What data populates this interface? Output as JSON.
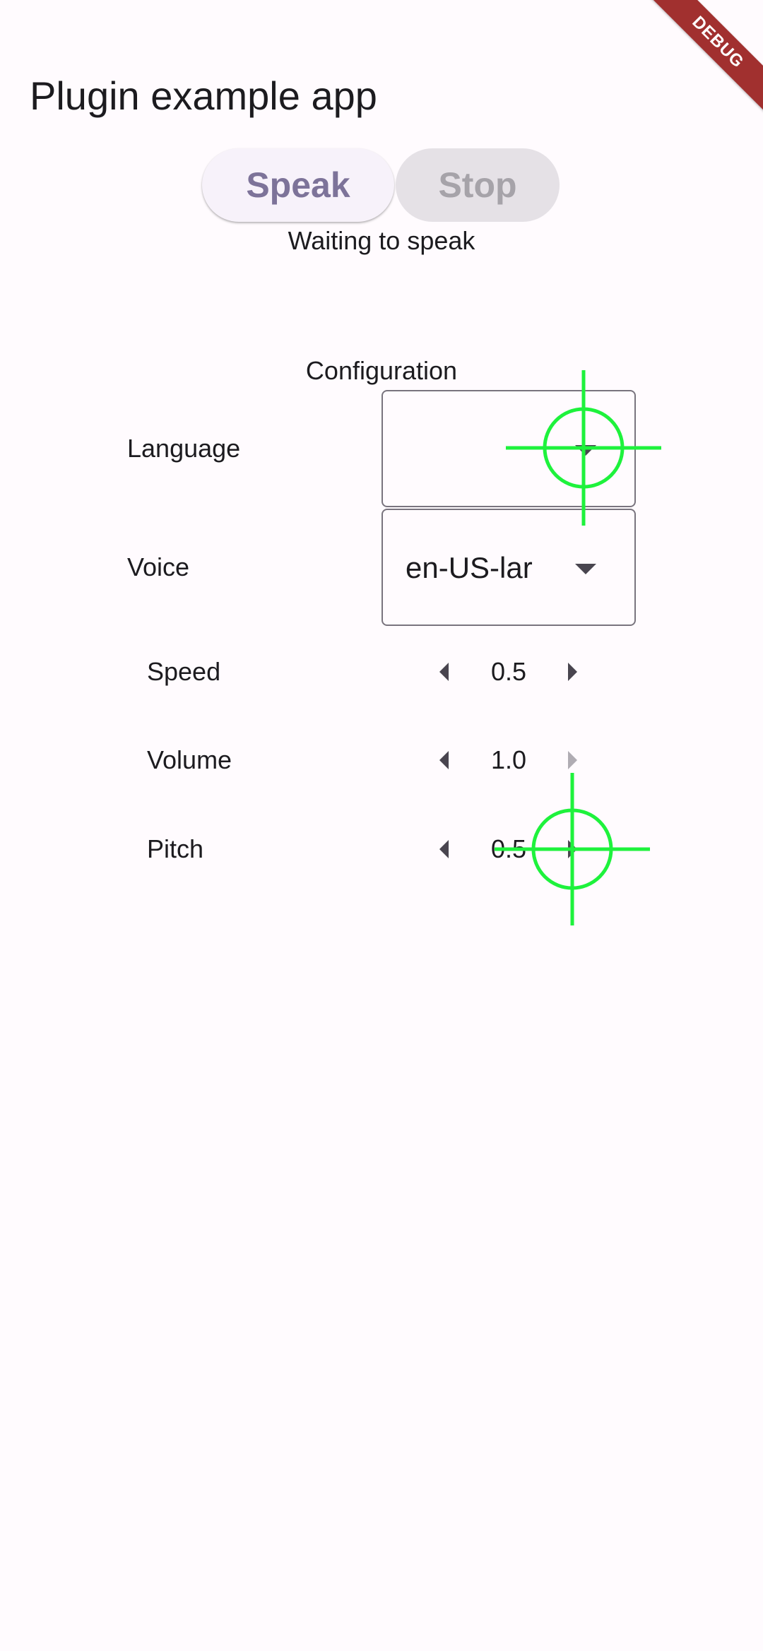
{
  "app_bar": {
    "title": "Plugin example app"
  },
  "actions": {
    "speak_label": "Speak",
    "stop_label": "Stop",
    "status": "Waiting to speak"
  },
  "configuration": {
    "title": "Configuration",
    "language": {
      "label": "Language",
      "value": ""
    },
    "voice": {
      "label": "Voice",
      "value": "en-US-lar"
    },
    "speed": {
      "label": "Speed",
      "value": "0.5"
    },
    "volume": {
      "label": "Volume",
      "value": "1.0"
    },
    "pitch": {
      "label": "Pitch",
      "value": "0.5"
    }
  },
  "debug_banner": {
    "label": "DEBUG"
  },
  "colors": {
    "background": "#fffbfe",
    "speak_button_bg": "#f7f2fa",
    "speak_button_text": "#7d7399",
    "stop_button_bg": "#e5e1e6",
    "stop_button_text": "#a6a3a9",
    "debug_banner": "#a1302f",
    "crosshair": "#1ef23c"
  },
  "icons": {
    "dropdown": "arrow-drop-down-icon",
    "decrement": "arrow-left-icon",
    "increment": "arrow-right-icon",
    "marker": "crosshair-icon"
  }
}
